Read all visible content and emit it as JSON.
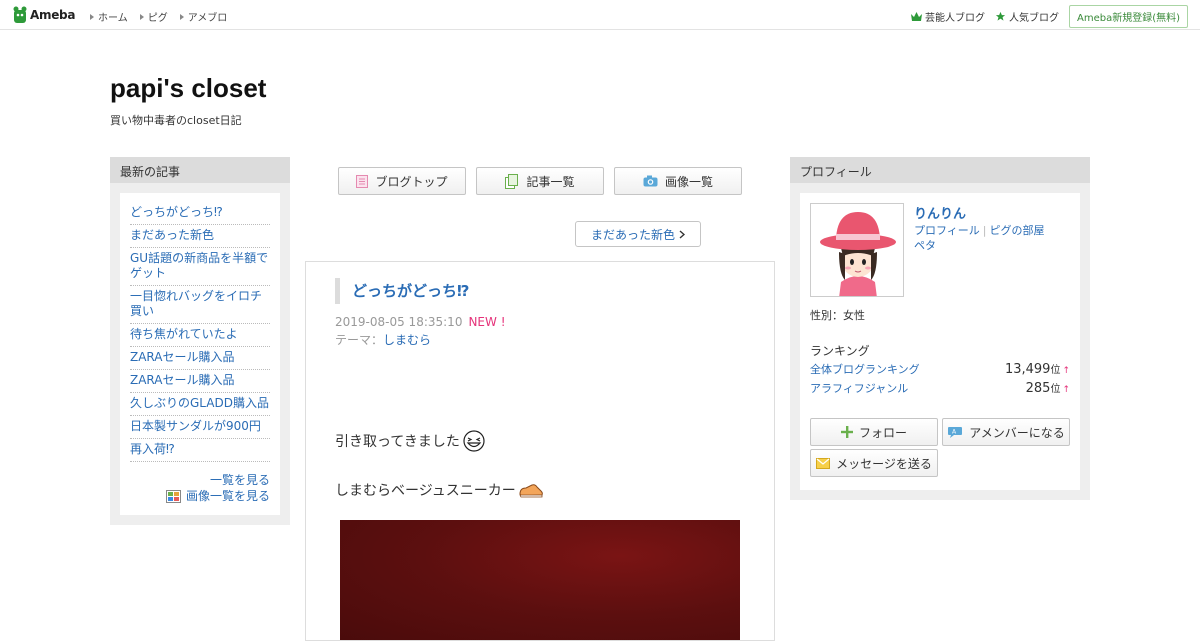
{
  "topbar": {
    "logo_text": "Ameba",
    "nav": [
      {
        "label": "ホーム"
      },
      {
        "label": "ピグ"
      },
      {
        "label": "アメブロ"
      }
    ],
    "right_links": [
      {
        "label": "芸能人ブログ",
        "icon": "crown-icon"
      },
      {
        "label": "人気ブログ",
        "icon": "star-icon"
      }
    ],
    "register_label": "Ameba新規登録(無料)"
  },
  "header": {
    "title": "papi's closet",
    "description": "買い物中毒者のcloset日記"
  },
  "left_sidebar": {
    "heading": "最新の記事",
    "items": [
      "どっちがどっち⁉",
      "まだあった新色",
      "GU話題の新商品を半額でゲット",
      "一目惚れバッグをイロチ買い",
      "待ち焦がれていたよ",
      "ZARAセール購入品",
      "ZARAセール購入品",
      "久しぶりのGLADD購入品",
      "日本製サンダルが900円",
      "再入荷⁉"
    ],
    "list_link": "一覧を見る",
    "image_list_link": "画像一覧を見る"
  },
  "center": {
    "nav_buttons": [
      {
        "label": "ブログトップ",
        "icon": "document-icon"
      },
      {
        "label": "記事一覧",
        "icon": "documents-icon"
      },
      {
        "label": "画像一覧",
        "icon": "camera-icon"
      }
    ],
    "next_label": "まだあった新色",
    "entry": {
      "title": "どっちがどっち⁉",
      "datetime": "2019-08-05 18:35:10",
      "new_label": "NEW !",
      "theme_label": "テーマ：",
      "theme": "しまむら",
      "line1": "引き取ってきました",
      "line2": "しまむらベージュスニーカー"
    }
  },
  "right_sidebar": {
    "heading": "プロフィール",
    "name": "りんりん",
    "links": [
      "プロフィール",
      "ピグの部屋",
      "ペタ"
    ],
    "gender": "性別：女性",
    "ranking_heading": "ランキング",
    "rankings": [
      {
        "label": "全体ブログランキング",
        "value": "13,499",
        "unit": "位",
        "trend": "↑"
      },
      {
        "label": "アラフィフジャンル",
        "value": "285",
        "unit": "位",
        "trend": "↑"
      }
    ],
    "follow_label": "フォロー",
    "amember_label": "アメンバーになる",
    "message_label": "メッセージを送る"
  },
  "colors": {
    "link": "#2a6cb5",
    "new": "#e5337a",
    "brand_green": "#3a8a3a"
  }
}
